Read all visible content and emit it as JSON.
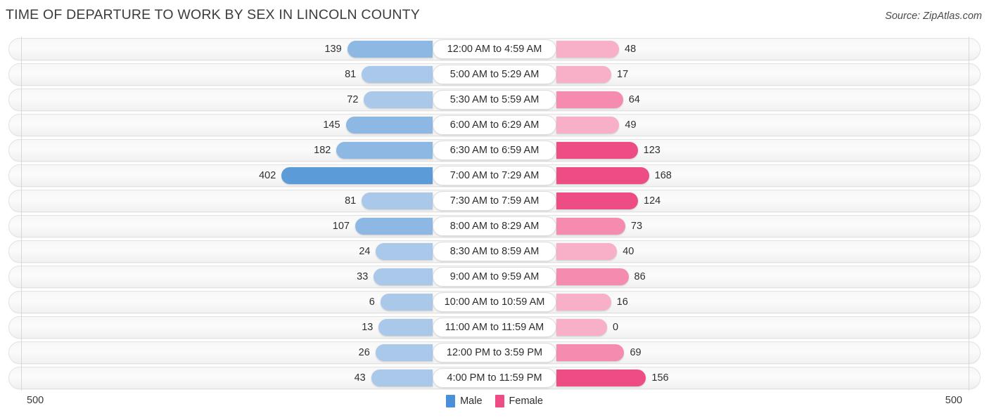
{
  "header": {
    "title": "TIME OF DEPARTURE TO WORK BY SEX IN LINCOLN COUNTY",
    "source": "Source: ZipAtlas.com"
  },
  "axis": {
    "left_max": "500",
    "right_max": "500"
  },
  "legend": {
    "items": [
      {
        "label": "Male",
        "color": "#4a90d9"
      },
      {
        "label": "Female",
        "color": "#ee4c84"
      }
    ]
  },
  "colors": {
    "male_light": "#aac8ea",
    "male_mid": "#8db8e3",
    "male_dark": "#5b9bd8",
    "female_light": "#f8afc8",
    "female_mid": "#f58cb0",
    "female_dark": "#ee4c84",
    "track": "#f6f6f6",
    "axis": "#d8d8d8"
  },
  "chart_data": {
    "type": "bar",
    "orientation": "horizontal-diverging",
    "title": "TIME OF DEPARTURE TO WORK BY SEX IN LINCOLN COUNTY",
    "xlabel": "",
    "ylabel": "",
    "xlim": [
      500,
      500
    ],
    "grid": false,
    "legend_position": "bottom-center",
    "categories": [
      "12:00 AM to 4:59 AM",
      "5:00 AM to 5:29 AM",
      "5:30 AM to 5:59 AM",
      "6:00 AM to 6:29 AM",
      "6:30 AM to 6:59 AM",
      "7:00 AM to 7:29 AM",
      "7:30 AM to 7:59 AM",
      "8:00 AM to 8:29 AM",
      "8:30 AM to 8:59 AM",
      "9:00 AM to 9:59 AM",
      "10:00 AM to 10:59 AM",
      "11:00 AM to 11:59 AM",
      "12:00 PM to 3:59 PM",
      "4:00 PM to 11:59 PM"
    ],
    "series": [
      {
        "name": "Male",
        "values": [
          139,
          81,
          72,
          145,
          182,
          402,
          81,
          107,
          24,
          33,
          6,
          13,
          26,
          43
        ]
      },
      {
        "name": "Female",
        "values": [
          48,
          17,
          64,
          49,
          123,
          168,
          124,
          73,
          40,
          86,
          16,
          0,
          69,
          156
        ]
      }
    ]
  },
  "rows": [
    {
      "category": "12:00 AM to 4:59 AM",
      "male": "139",
      "female": "48"
    },
    {
      "category": "5:00 AM to 5:29 AM",
      "male": "81",
      "female": "17"
    },
    {
      "category": "5:30 AM to 5:59 AM",
      "male": "72",
      "female": "64"
    },
    {
      "category": "6:00 AM to 6:29 AM",
      "male": "145",
      "female": "49"
    },
    {
      "category": "6:30 AM to 6:59 AM",
      "male": "182",
      "female": "123"
    },
    {
      "category": "7:00 AM to 7:29 AM",
      "male": "402",
      "female": "168"
    },
    {
      "category": "7:30 AM to 7:59 AM",
      "male": "81",
      "female": "124"
    },
    {
      "category": "8:00 AM to 8:29 AM",
      "male": "107",
      "female": "73"
    },
    {
      "category": "8:30 AM to 8:59 AM",
      "male": "24",
      "female": "40"
    },
    {
      "category": "9:00 AM to 9:59 AM",
      "male": "33",
      "female": "86"
    },
    {
      "category": "10:00 AM to 10:59 AM",
      "male": "6",
      "female": "16"
    },
    {
      "category": "11:00 AM to 11:59 AM",
      "male": "13",
      "female": "0"
    },
    {
      "category": "12:00 PM to 3:59 PM",
      "male": "26",
      "female": "69"
    },
    {
      "category": "4:00 PM to 11:59 PM",
      "male": "43",
      "female": "156"
    }
  ]
}
